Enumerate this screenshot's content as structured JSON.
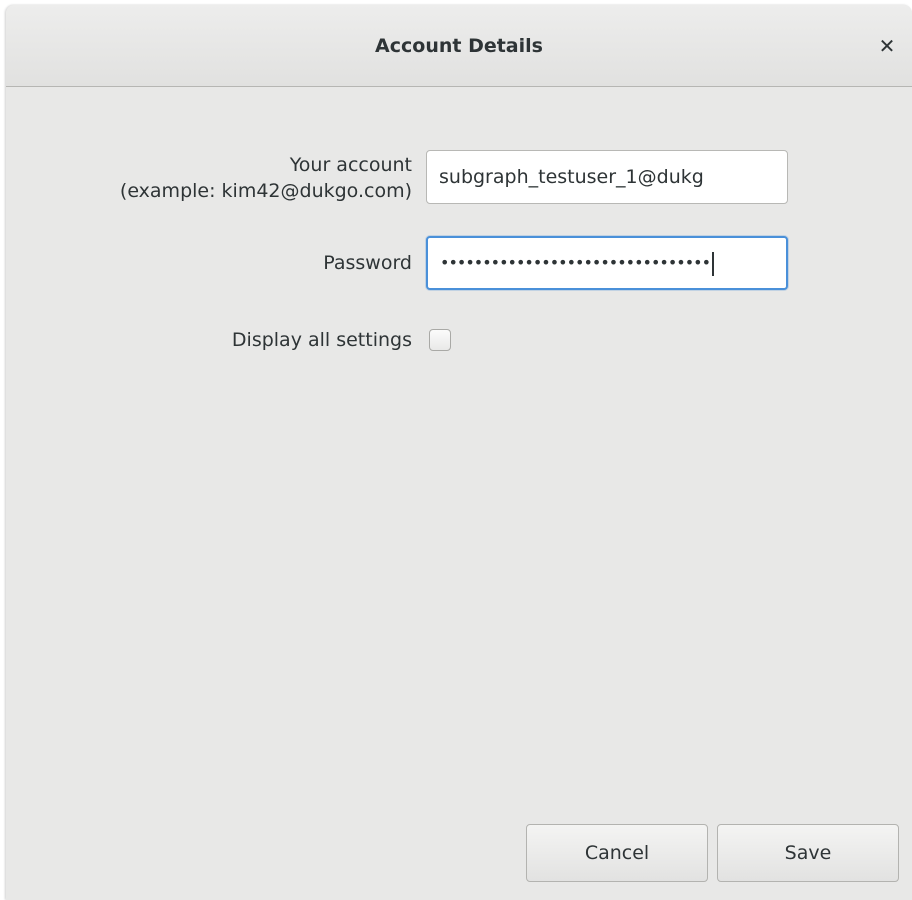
{
  "dialog": {
    "title": "Account Details",
    "close_icon": "close-icon",
    "close_glyph": "✕"
  },
  "form": {
    "account_label_line1": "Your account",
    "account_label_line2": "(example: kim42@dukgo.com)",
    "account_value": "subgraph_testuser_1@dukg",
    "password_label": "Password",
    "password_masked": "••••••••••••••••••••••••••••••••",
    "display_all_settings_label": "Display all settings",
    "display_all_settings_checked": false
  },
  "buttons": {
    "cancel_label": "Cancel",
    "save_label": "Save"
  }
}
